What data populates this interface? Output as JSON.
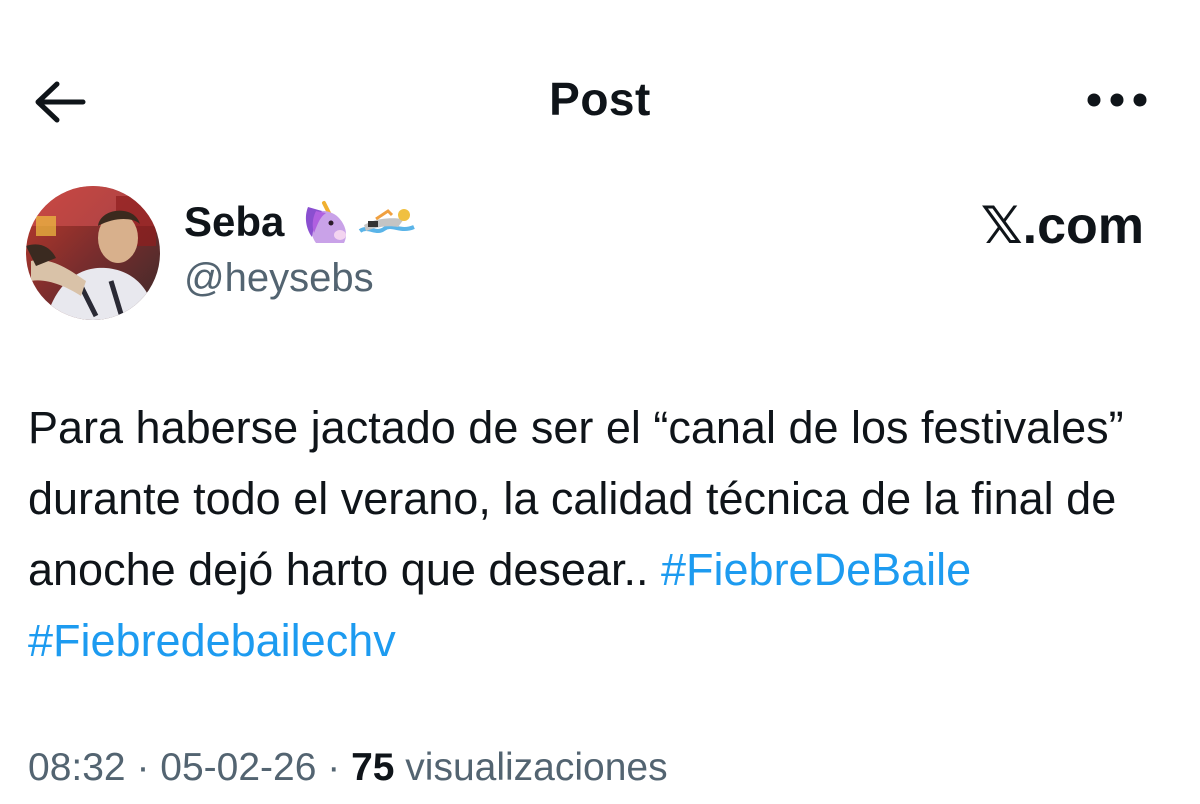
{
  "header": {
    "title": "Post",
    "back_icon": "arrow-left-icon",
    "more_icon": "more-horizontal-icon"
  },
  "author": {
    "name": "Seba",
    "handle": "@heysebs",
    "badges": [
      "unicorn-emoji",
      "swimmer-emoji"
    ],
    "source": "𝕏.com"
  },
  "post": {
    "text": "Para haberse jactado de ser el “canal de los festivales” durante todo el verano, la calidad técnica de la final de anoche dejó harto que desear.. ",
    "hashtags": [
      "#FiebreDeBaile",
      "#Fiebredebailechv"
    ]
  },
  "meta": {
    "time": "08:32",
    "separator": " · ",
    "date": "05-02-26",
    "views_count": "75",
    "views_label": " visualizaciones"
  },
  "colors": {
    "text": "#0f1419",
    "secondary": "#536471",
    "link": "#1d9bf0",
    "background": "#ffffff"
  }
}
